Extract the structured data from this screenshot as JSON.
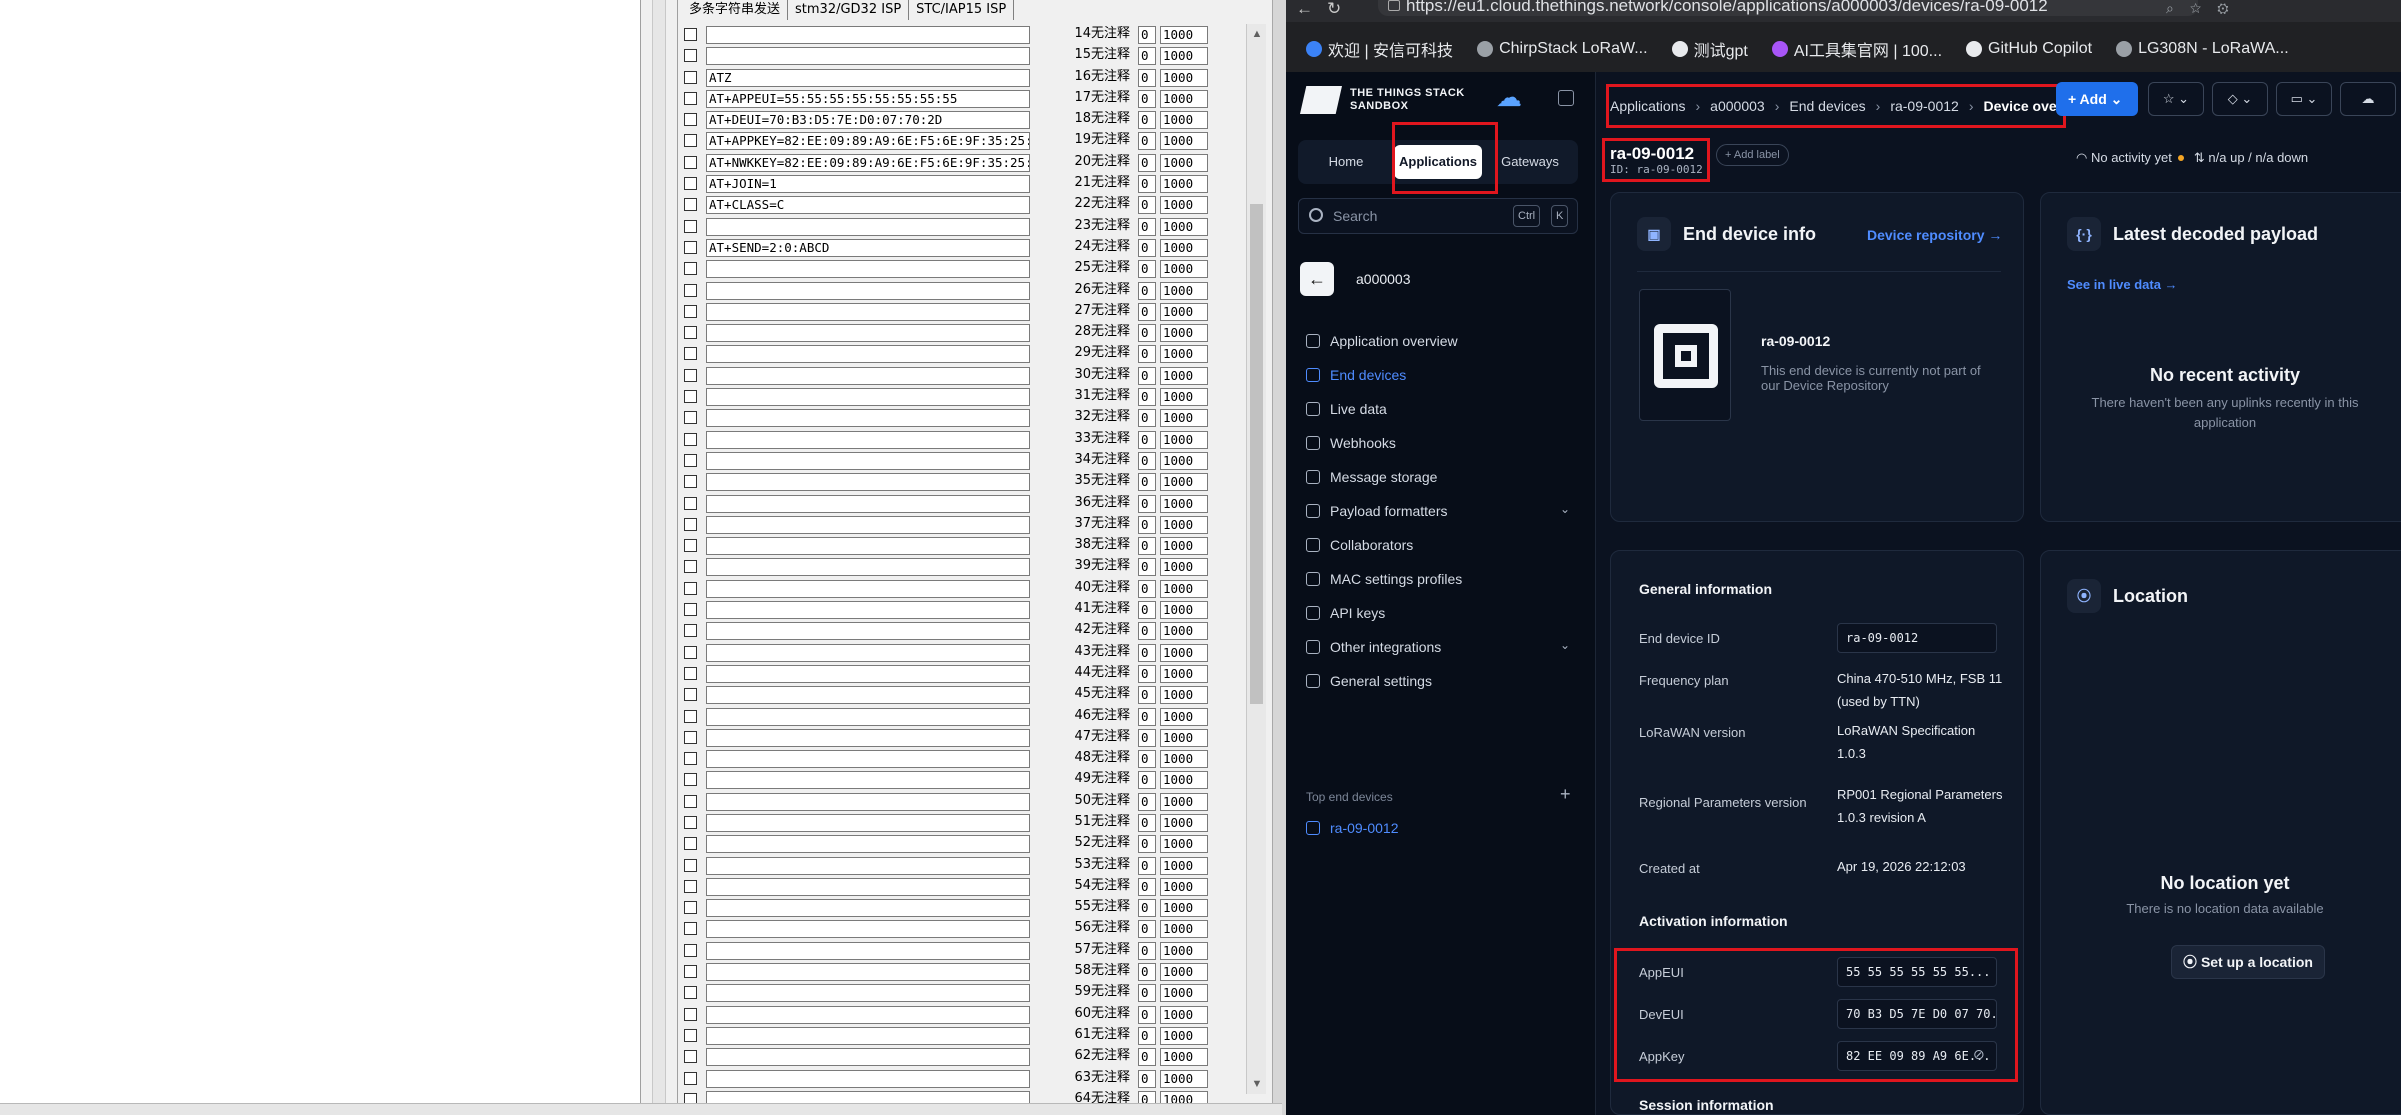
{
  "serial_tool": {
    "tabs": [
      "多条字符串发送",
      "stm32/GD32 ISP",
      "STC/IAP15 ISP"
    ],
    "rows": [
      {
        "text": "",
        "btn": "14无注释",
        "v0": "0",
        "v1": "1000"
      },
      {
        "text": "",
        "btn": "15无注释",
        "v0": "0",
        "v1": "1000"
      },
      {
        "text": "ATZ",
        "btn": "16无注释",
        "v0": "0",
        "v1": "1000"
      },
      {
        "text": "AT+APPEUI=55:55:55:55:55:55:55:55",
        "btn": "17无注释",
        "v0": "0",
        "v1": "1000"
      },
      {
        "text": "AT+DEUI=70:B3:D5:7E:D0:07:70:2D",
        "btn": "18无注释",
        "v0": "0",
        "v1": "1000"
      },
      {
        "text": "AT+APPKEY=82:EE:09:89:A9:6E:F5:6E:9F:35:25:",
        "btn": "19无注释",
        "v0": "0",
        "v1": "1000"
      },
      {
        "text": "AT+NWKKEY=82:EE:09:89:A9:6E:F5:6E:9F:35:25:",
        "btn": "20无注释",
        "v0": "0",
        "v1": "1000"
      },
      {
        "text": "AT+JOIN=1",
        "btn": "21无注释",
        "v0": "0",
        "v1": "1000"
      },
      {
        "text": "AT+CLASS=C",
        "btn": "22无注释",
        "v0": "0",
        "v1": "1000"
      },
      {
        "text": "",
        "btn": "23无注释",
        "v0": "0",
        "v1": "1000"
      },
      {
        "text": "AT+SEND=2:0:ABCD",
        "btn": "24无注释",
        "v0": "0",
        "v1": "1000"
      },
      {
        "text": "",
        "btn": "25无注释",
        "v0": "0",
        "v1": "1000"
      },
      {
        "text": "",
        "btn": "26无注释",
        "v0": "0",
        "v1": "1000"
      },
      {
        "text": "",
        "btn": "27无注释",
        "v0": "0",
        "v1": "1000"
      },
      {
        "text": "",
        "btn": "28无注释",
        "v0": "0",
        "v1": "1000"
      },
      {
        "text": "",
        "btn": "29无注释",
        "v0": "0",
        "v1": "1000"
      },
      {
        "text": "",
        "btn": "30无注释",
        "v0": "0",
        "v1": "1000"
      },
      {
        "text": "",
        "btn": "31无注释",
        "v0": "0",
        "v1": "1000"
      },
      {
        "text": "",
        "btn": "32无注释",
        "v0": "0",
        "v1": "1000"
      },
      {
        "text": "",
        "btn": "33无注释",
        "v0": "0",
        "v1": "1000"
      },
      {
        "text": "",
        "btn": "34无注释",
        "v0": "0",
        "v1": "1000"
      },
      {
        "text": "",
        "btn": "35无注释",
        "v0": "0",
        "v1": "1000"
      },
      {
        "text": "",
        "btn": "36无注释",
        "v0": "0",
        "v1": "1000"
      },
      {
        "text": "",
        "btn": "37无注释",
        "v0": "0",
        "v1": "1000"
      },
      {
        "text": "",
        "btn": "38无注释",
        "v0": "0",
        "v1": "1000"
      },
      {
        "text": "",
        "btn": "39无注释",
        "v0": "0",
        "v1": "1000"
      },
      {
        "text": "",
        "btn": "40无注释",
        "v0": "0",
        "v1": "1000"
      },
      {
        "text": "",
        "btn": "41无注释",
        "v0": "0",
        "v1": "1000"
      },
      {
        "text": "",
        "btn": "42无注释",
        "v0": "0",
        "v1": "1000"
      },
      {
        "text": "",
        "btn": "43无注释",
        "v0": "0",
        "v1": "1000"
      },
      {
        "text": "",
        "btn": "44无注释",
        "v0": "0",
        "v1": "1000"
      },
      {
        "text": "",
        "btn": "45无注释",
        "v0": "0",
        "v1": "1000"
      },
      {
        "text": "",
        "btn": "46无注释",
        "v0": "0",
        "v1": "1000"
      },
      {
        "text": "",
        "btn": "47无注释",
        "v0": "0",
        "v1": "1000"
      },
      {
        "text": "",
        "btn": "48无注释",
        "v0": "0",
        "v1": "1000"
      },
      {
        "text": "",
        "btn": "49无注释",
        "v0": "0",
        "v1": "1000"
      },
      {
        "text": "",
        "btn": "50无注释",
        "v0": "0",
        "v1": "1000"
      },
      {
        "text": "",
        "btn": "51无注释",
        "v0": "0",
        "v1": "1000"
      },
      {
        "text": "",
        "btn": "52无注释",
        "v0": "0",
        "v1": "1000"
      },
      {
        "text": "",
        "btn": "53无注释",
        "v0": "0",
        "v1": "1000"
      },
      {
        "text": "",
        "btn": "54无注释",
        "v0": "0",
        "v1": "1000"
      },
      {
        "text": "",
        "btn": "55无注释",
        "v0": "0",
        "v1": "1000"
      },
      {
        "text": "",
        "btn": "56无注释",
        "v0": "0",
        "v1": "1000"
      },
      {
        "text": "",
        "btn": "57无注释",
        "v0": "0",
        "v1": "1000"
      },
      {
        "text": "",
        "btn": "58无注释",
        "v0": "0",
        "v1": "1000"
      },
      {
        "text": "",
        "btn": "59无注释",
        "v0": "0",
        "v1": "1000"
      },
      {
        "text": "",
        "btn": "60无注释",
        "v0": "0",
        "v1": "1000"
      },
      {
        "text": "",
        "btn": "61无注释",
        "v0": "0",
        "v1": "1000"
      },
      {
        "text": "",
        "btn": "62无注释",
        "v0": "0",
        "v1": "1000"
      },
      {
        "text": "",
        "btn": "63无注释",
        "v0": "0",
        "v1": "1000"
      },
      {
        "text": "",
        "btn": "64无注释",
        "v0": "0",
        "v1": "1000"
      }
    ]
  },
  "browser": {
    "url": "https://eu1.cloud.thethings.network/console/applications/a000003/devices/ra-09-0012",
    "bookmarks": [
      {
        "label": "欢迎 | 安信可科技",
        "color": "#3b82f6"
      },
      {
        "label": "ChirpStack LoRaW...",
        "color": "#9aa0a6"
      },
      {
        "label": "测试gpt",
        "color": "#e8eaed"
      },
      {
        "label": "AI工具集官网 | 100...",
        "color": "#a855f7"
      },
      {
        "label": "GitHub Copilot",
        "color": "#e8eaed"
      },
      {
        "label": "LG308N - LoRaWA...",
        "color": "#9aa0a6"
      }
    ]
  },
  "ttn": {
    "logo_line1": "THE THINGS STACK",
    "logo_line2": "SANDBOX",
    "seg": {
      "home": "Home",
      "applications": "Applications",
      "gateways": "Gateways"
    },
    "search": {
      "placeholder": "Search",
      "kbd1": "Ctrl",
      "kbd2": "K"
    },
    "app_name": "a000003",
    "nav": [
      {
        "label": "Application overview",
        "active": false,
        "chevron": false
      },
      {
        "label": "End devices",
        "active": true,
        "chevron": false
      },
      {
        "label": "Live data",
        "active": false,
        "chevron": false
      },
      {
        "label": "Webhooks",
        "active": false,
        "chevron": false
      },
      {
        "label": "Message storage",
        "active": false,
        "chevron": false
      },
      {
        "label": "Payload formatters",
        "active": false,
        "chevron": true
      },
      {
        "label": "Collaborators",
        "active": false,
        "chevron": false
      },
      {
        "label": "MAC settings profiles",
        "active": false,
        "chevron": false
      },
      {
        "label": "API keys",
        "active": false,
        "chevron": false
      },
      {
        "label": "Other integrations",
        "active": false,
        "chevron": true
      },
      {
        "label": "General settings",
        "active": false,
        "chevron": false
      }
    ],
    "top_devices_heading": "Top end devices",
    "top_device": "ra-09-0012",
    "breadcrumb": [
      "Applications",
      "a000003",
      "End devices",
      "ra-09-0012",
      "Device overview"
    ],
    "add_button": "Add",
    "device_title": "ra-09-0012",
    "device_id_line": "ID: ra-09-0012",
    "add_label": "Add label",
    "activity": {
      "status": "No activity yet",
      "traffic": "n/a up / n/a down"
    },
    "end_device_info": {
      "title": "End device info",
      "repo_link": "Device repository →",
      "name": "ra-09-0012",
      "note": "This end device is currently not part of our Device Repository"
    },
    "payload": {
      "title": "Latest decoded payload",
      "live_link": "See in live data →",
      "empty_title": "No recent activity",
      "empty_text": "There haven't been any uplinks recently in this application"
    },
    "general": {
      "title": "General information",
      "rows": [
        {
          "key": "End device ID",
          "value": "ra-09-0012"
        },
        {
          "key": "Frequency plan",
          "value": "China 470-510 MHz, FSB 11 (used by TTN)"
        },
        {
          "key": "LoRaWAN version",
          "value": "LoRaWAN Specification 1.0.3"
        },
        {
          "key": "Regional Parameters version",
          "value": "RP001 Regional Parameters 1.0.3 revision A"
        },
        {
          "key": "Created at",
          "value": "Apr 19, 2026 22:12:03"
        }
      ]
    },
    "activation": {
      "title": "Activation information",
      "rows": [
        {
          "key": "AppEUI",
          "value": "55 55 55 55 55 55..."
        },
        {
          "key": "DevEUI",
          "value": "70 B3 D5 7E D0 07 70..."
        },
        {
          "key": "AppKey",
          "value": "82 EE 09 89 A9 6E..."
        }
      ]
    },
    "session_title": "Session information",
    "location": {
      "title": "Location",
      "empty_title": "No location yet",
      "empty_text": "There is no location data available",
      "button": "Set up a location"
    }
  },
  "colors": {
    "highlight": "#e0161e",
    "accent": "#4f8cff",
    "add_button": "#1f6feb"
  }
}
